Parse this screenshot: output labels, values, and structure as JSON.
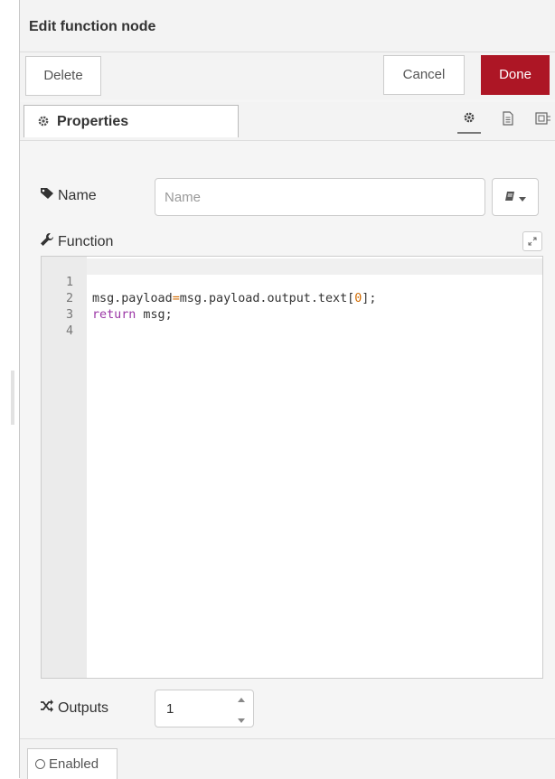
{
  "dialog": {
    "title": "Edit function node"
  },
  "toolbar": {
    "delete_label": "Delete",
    "cancel_label": "Cancel",
    "done_label": "Done",
    "done_color": "#ad1625"
  },
  "tabs": {
    "properties_label": "Properties",
    "icons": [
      "gear-icon",
      "document-icon",
      "appearance-icon"
    ]
  },
  "form": {
    "name_label": "Name",
    "name_value": "",
    "name_placeholder": "Name",
    "function_label": "Function",
    "outputs_label": "Outputs",
    "outputs_value": "1"
  },
  "editor": {
    "line_numbers": [
      "1",
      "2",
      "3",
      "4"
    ],
    "code_lines": [
      "msg.payload=msg.payload.output.text[0];",
      "return msg;",
      "",
      ""
    ]
  },
  "footer": {
    "enabled_label": "Enabled"
  }
}
